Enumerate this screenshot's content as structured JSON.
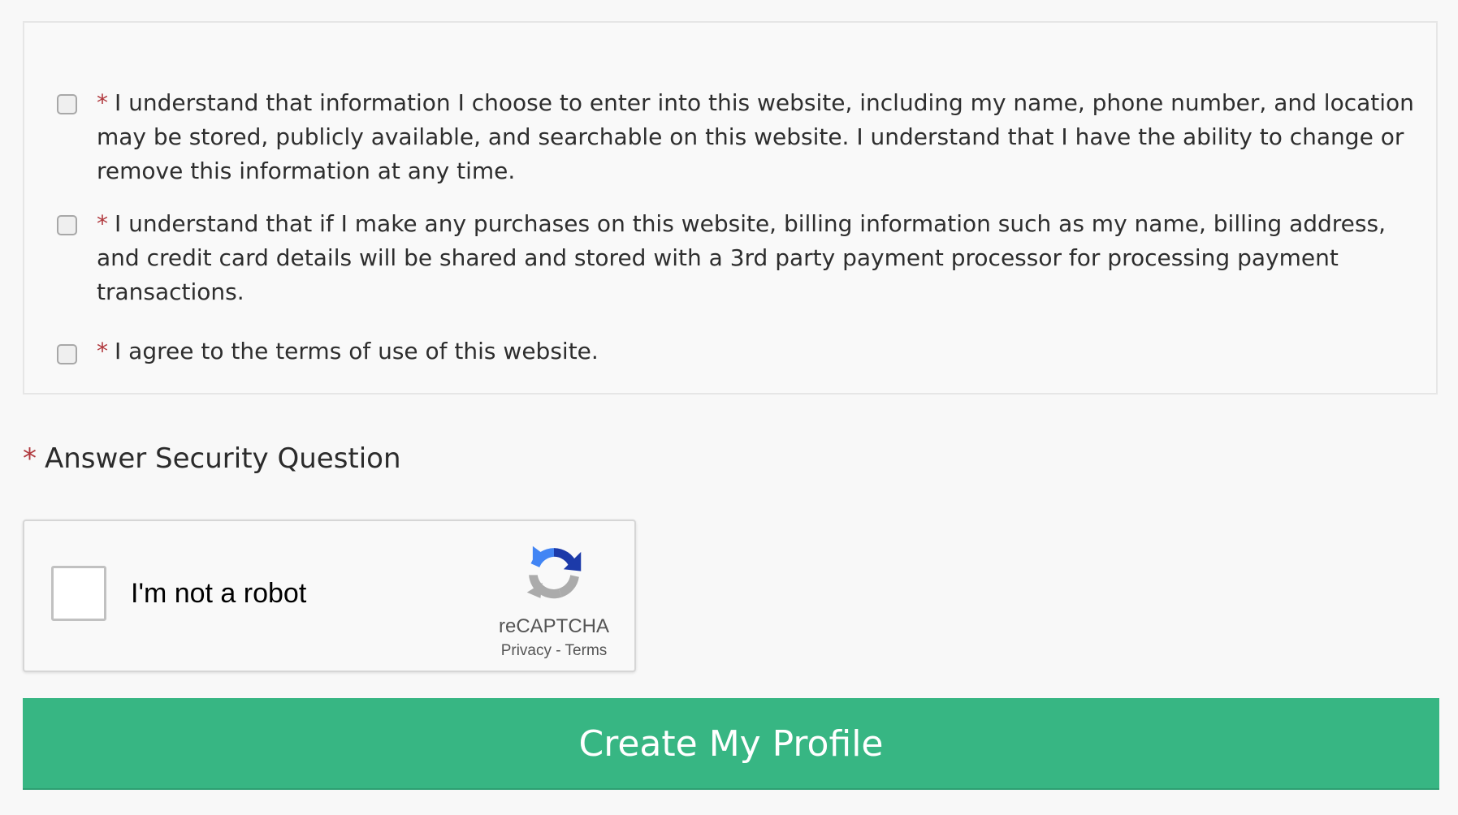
{
  "consents": [
    {
      "required_marker": "*",
      "text": "I understand that information I choose to enter into this website, including my name, phone number, and location may be stored, publicly available, and searchable on this website. I understand that I have the ability to change or remove this information at any time.",
      "checked": false
    },
    {
      "required_marker": "*",
      "text": "I understand that if I make any purchases on this website, billing information such as my name, billing address, and credit card details will be shared and stored with a 3rd party payment processor for processing payment transactions.",
      "checked": false
    },
    {
      "required_marker": "*",
      "text": "I agree to the terms of use of this website.",
      "checked": false
    }
  ],
  "security": {
    "required_marker": "*",
    "heading": "Answer Security Question"
  },
  "recaptcha": {
    "label": "I'm not a robot",
    "brand": "reCAPTCHA",
    "privacy_link": "Privacy",
    "separator": " - ",
    "terms_link": "Terms",
    "icon": "recaptcha-logo-icon"
  },
  "submit": {
    "label": "Create My Profile"
  },
  "colors": {
    "required": "#b0383d",
    "button": "#37b683",
    "background": "#f8f8f8"
  }
}
